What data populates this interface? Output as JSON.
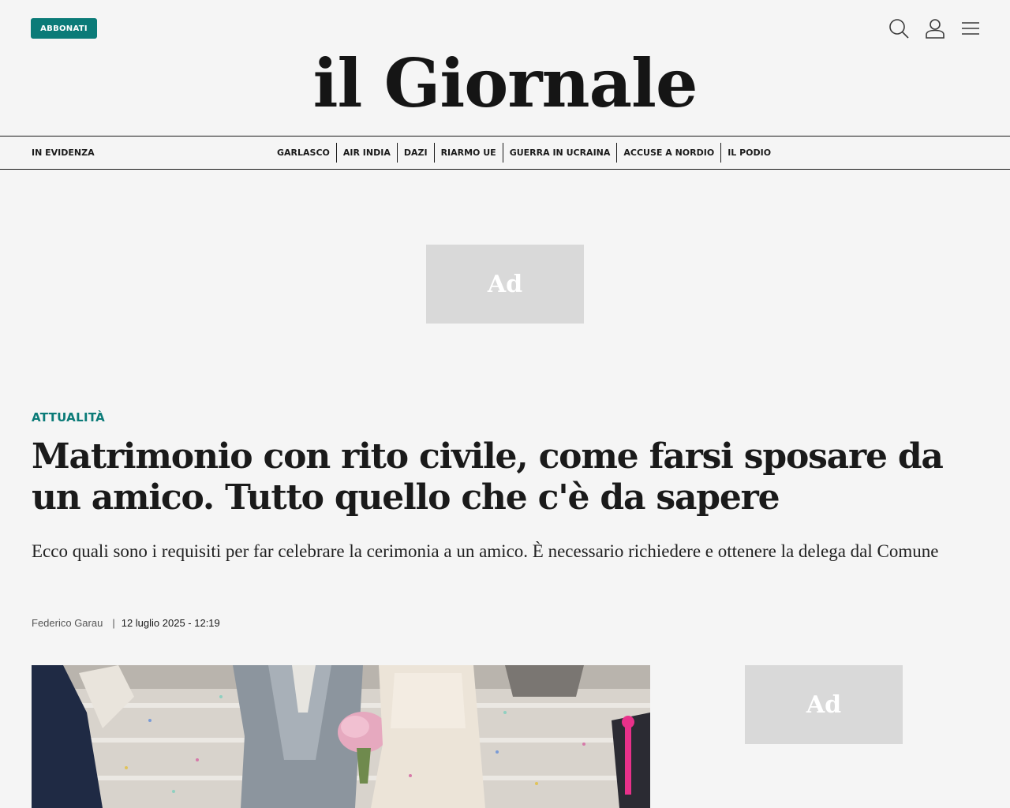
{
  "header": {
    "subscribe_label": "ABBONATI",
    "logo": "il Giornale",
    "icons": [
      "search-icon",
      "user-icon",
      "menu-icon"
    ]
  },
  "nav": {
    "highlight_label": "IN EVIDENZA",
    "items": [
      "GARLASCO",
      "AIR INDIA",
      "DAZI",
      "RIARMO UE",
      "GUERRA IN UCRAINA",
      "ACCUSE A NORDIO",
      "IL PODIO"
    ]
  },
  "ads": {
    "top_label": "Ad",
    "side_label": "Ad"
  },
  "article": {
    "category": "ATTUALITÀ",
    "headline": "Matrimonio con rito civile, come farsi sposare da un amico. Tutto quello che c'è da sapere",
    "subtitle": "Ecco quali sono i requisiti per far celebrare la cerimonia a un amico. È necessario richiedere e ottenere la delega dal Comune",
    "author": "Federico Garau",
    "separator": "|",
    "date": "12 luglio 2025 - 12:19"
  },
  "colors": {
    "accent": "#0b7b78",
    "background": "#f5f5f5",
    "text": "#1a1a1a",
    "ad_placeholder": "#d9d9d9"
  }
}
